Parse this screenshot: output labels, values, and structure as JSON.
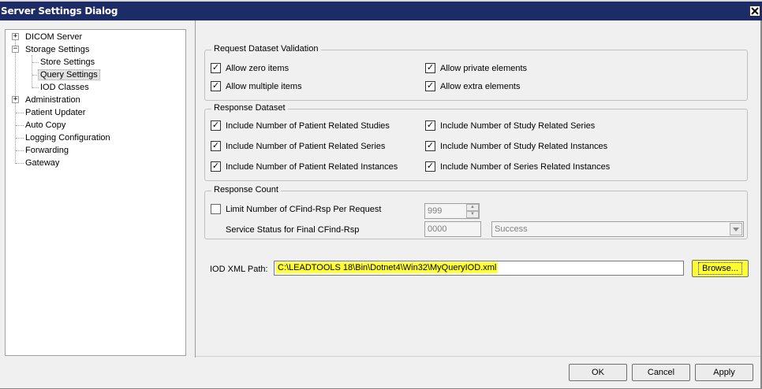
{
  "window": {
    "title": "Server Settings Dialog",
    "close_glyph": "✕"
  },
  "tree": {
    "items": [
      {
        "label": "DICOM Server",
        "expander": "+"
      },
      {
        "label": "Storage Settings",
        "expander": "−"
      },
      {
        "label": "Store Settings"
      },
      {
        "label": "Query Settings",
        "selected": true
      },
      {
        "label": "IOD Classes"
      },
      {
        "label": "Administration",
        "expander": "+"
      },
      {
        "label": "Patient Updater"
      },
      {
        "label": "Auto Copy"
      },
      {
        "label": "Logging Configuration"
      },
      {
        "label": "Forwarding"
      },
      {
        "label": "Gateway"
      }
    ]
  },
  "request_validation": {
    "legend": "Request Dataset Validation",
    "allow_zero": {
      "label": "Allow zero items",
      "checked": true
    },
    "allow_multiple": {
      "label": "Allow multiple items",
      "checked": true
    },
    "allow_private": {
      "label": "Allow private elements",
      "checked": true
    },
    "allow_extra": {
      "label": "Allow extra elements",
      "checked": true
    }
  },
  "response_dataset": {
    "legend": "Response Dataset",
    "patient_studies": {
      "label": "Include Number of Patient Related Studies",
      "checked": true
    },
    "patient_series": {
      "label": "Include Number of Patient Related Series",
      "checked": true
    },
    "patient_instances": {
      "label": "Include Number of Patient Related Instances",
      "checked": true
    },
    "study_series": {
      "label": "Include Number of Study Related Series",
      "checked": true
    },
    "study_instances": {
      "label": "Include Number of Study Related Instances",
      "checked": true
    },
    "series_instances": {
      "label": "Include Number of Series Related Instances",
      "checked": true
    }
  },
  "response_count": {
    "legend": "Response Count",
    "limit": {
      "label": "Limit Number of CFind-Rsp Per Request",
      "checked": false
    },
    "limit_value": "999",
    "status_label": "Service Status for Final CFind-Rsp",
    "status_code": "0000",
    "status_option": "Success"
  },
  "iod": {
    "label": "IOD XML Path:",
    "path": "C:\\LEADTOOLS 18\\Bin\\Dotnet4\\Win32\\MyQueryIOD.xml",
    "browse": "Browse..."
  },
  "buttons": {
    "ok": "OK",
    "cancel": "Cancel",
    "apply": "Apply"
  },
  "colors": {
    "titlebar": "#1d2c66",
    "highlight": "#ffff33"
  }
}
